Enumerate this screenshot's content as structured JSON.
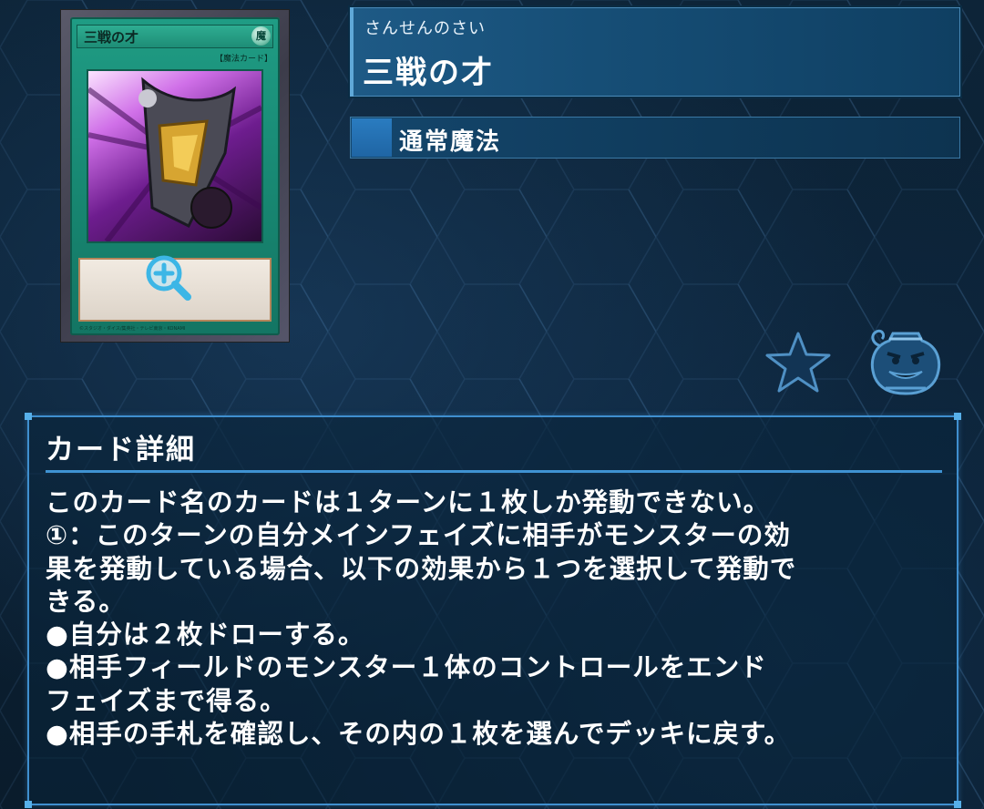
{
  "card": {
    "image_name": "三戦の才",
    "image_attribute": "魔",
    "image_type": "【魔法カード】",
    "image_footer": "©スタジオ・ダイス/集英社・テレビ東京・KONAMI"
  },
  "header": {
    "ruby": "さんせんのさい",
    "name": "三戦の才",
    "card_type": "通常魔法"
  },
  "icons": {
    "favorite": "star-icon",
    "deck": "pot-of-greed-icon",
    "zoom": "zoom-in-icon"
  },
  "details": {
    "title": "カード詳細",
    "lines": [
      "このカード名のカードは１ターンに１枚しか発動できない。",
      "①：このターンの自分メインフェイズに相手がモンスターの効",
      "果を発動している場合、以下の効果から１つを選択して発動で",
      "きる。",
      "●自分は２枚ドローする。",
      "●相手フィールドのモンスター１体のコントロールをエンド",
      "フェイズまで得る。",
      "●相手の手札を確認し、その内の１枚を選んでデッキに戻す。"
    ]
  },
  "colors": {
    "accent": "#3f8fcf",
    "spell_green": "#1f9c84",
    "panel_blue": "#1e5a86"
  }
}
